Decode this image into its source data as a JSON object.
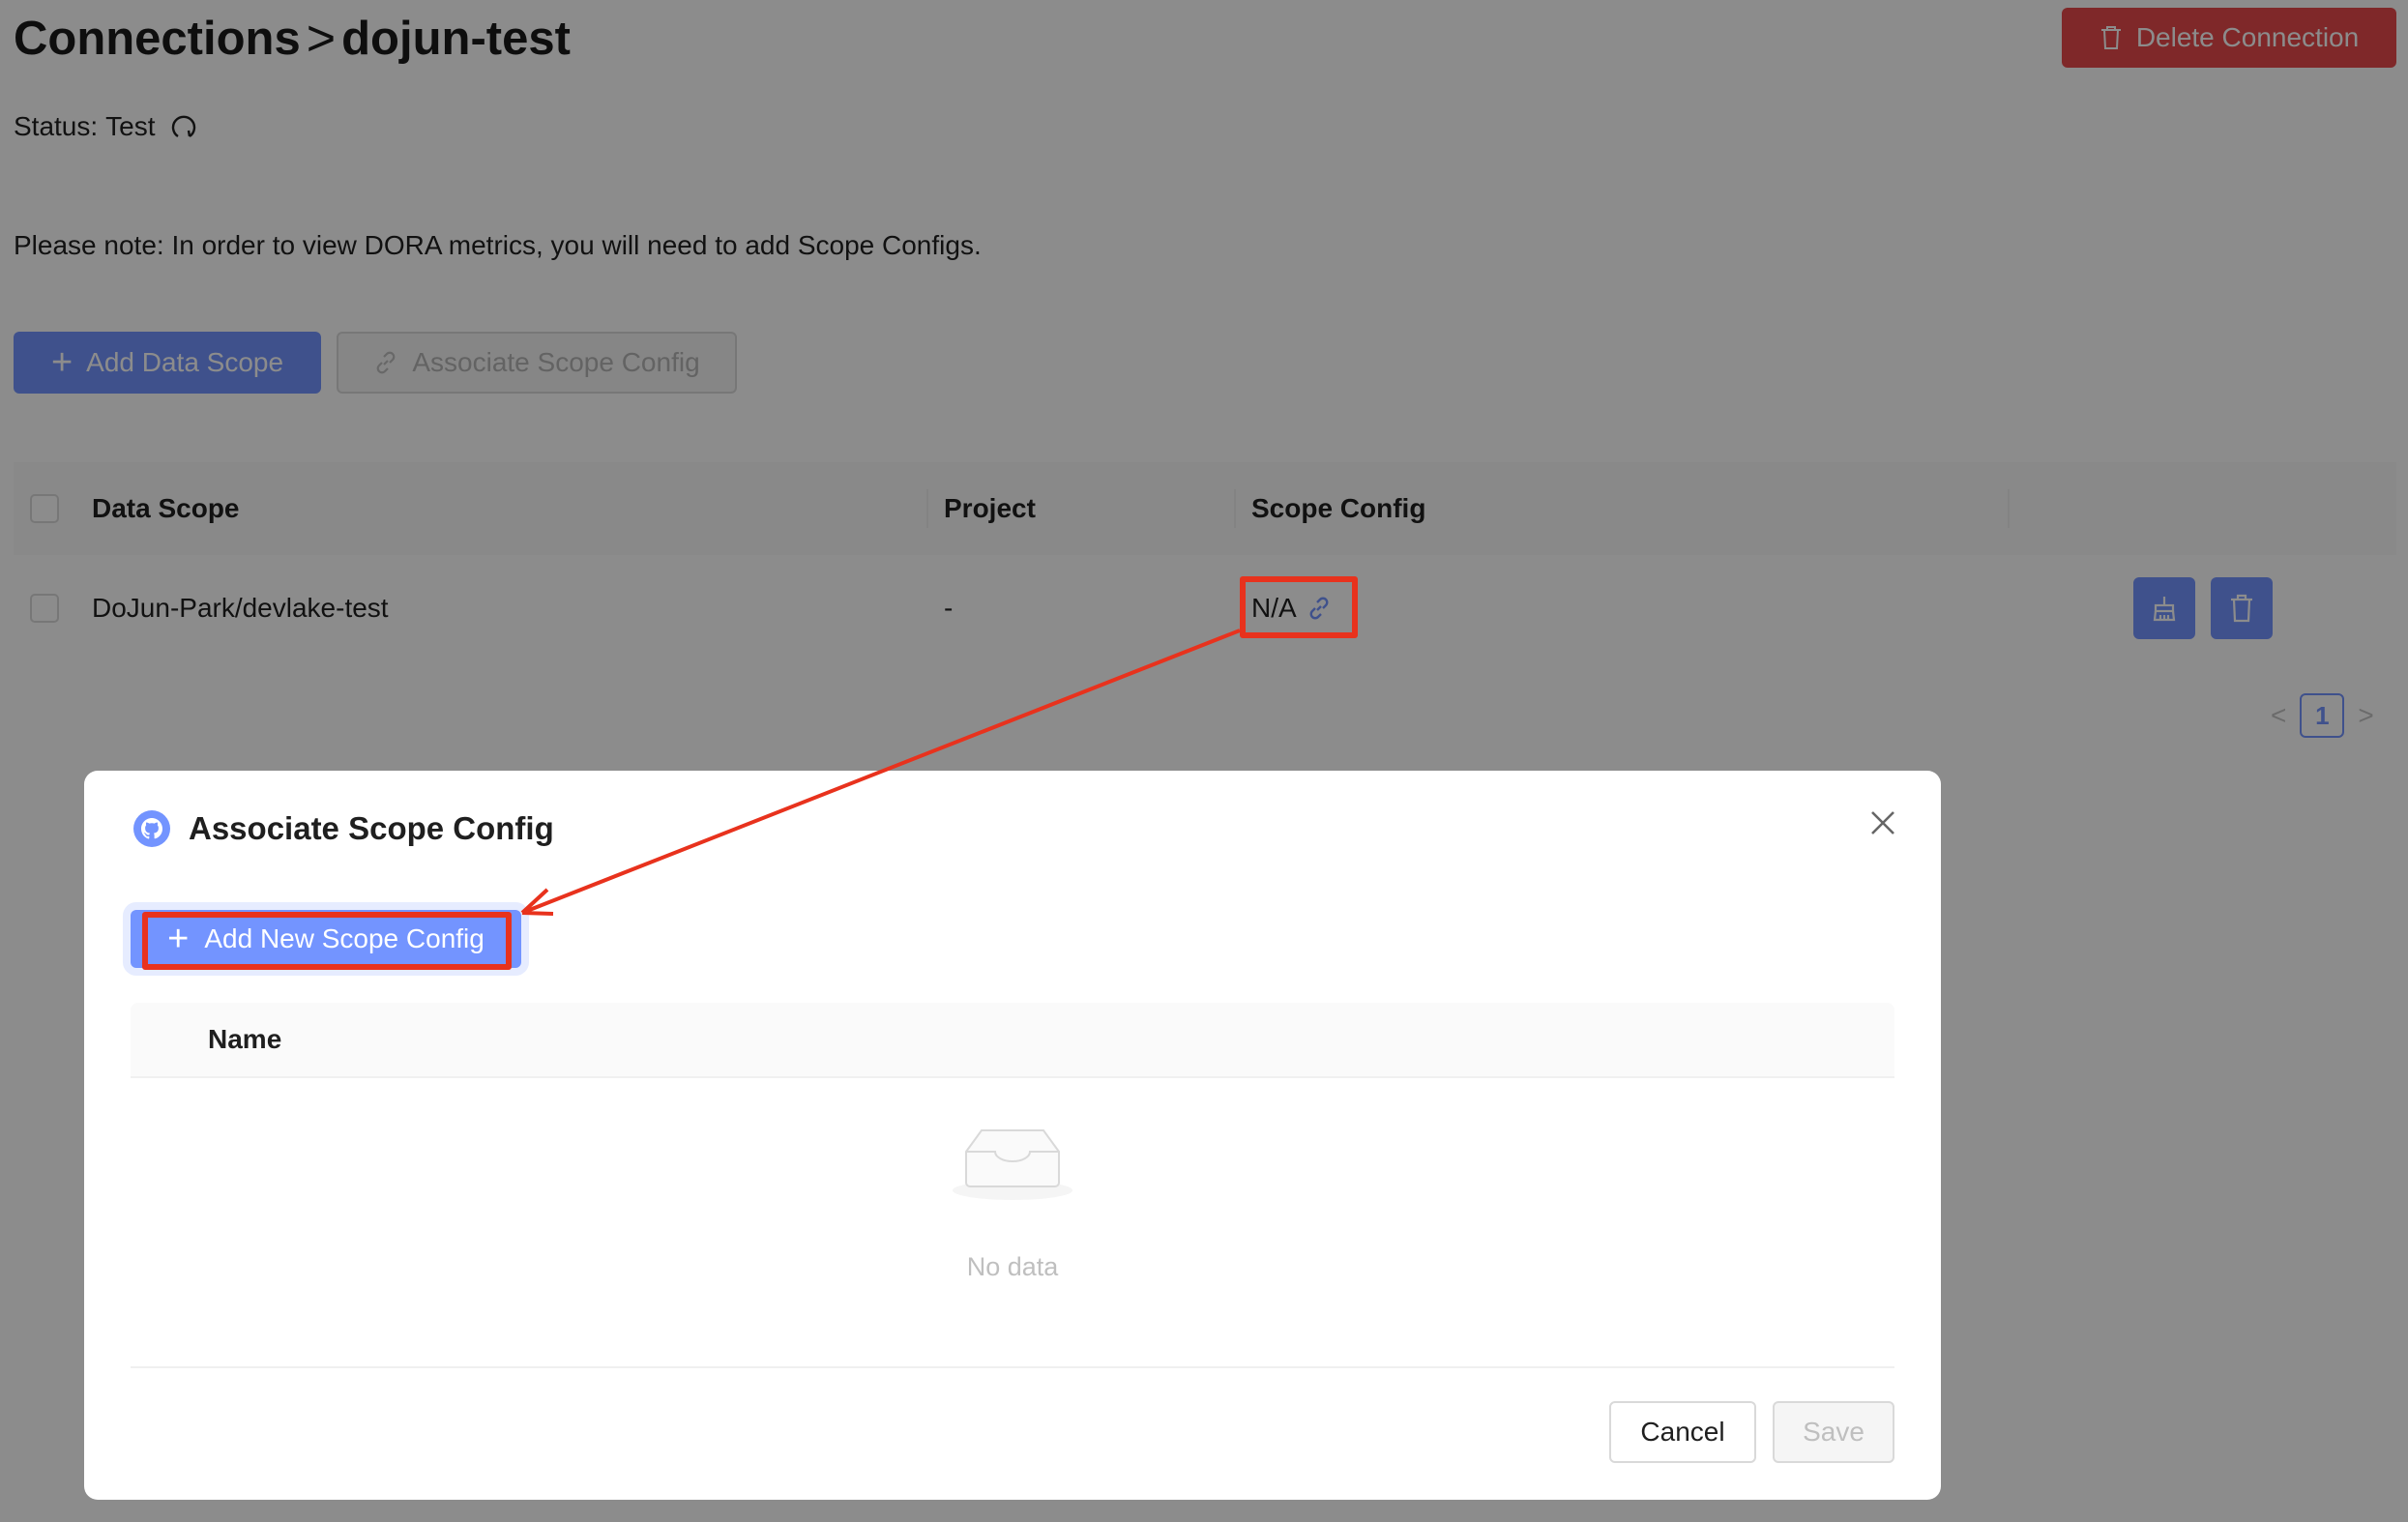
{
  "header": {
    "breadcrumb_root": "Connections",
    "breadcrumb_sep": ">",
    "breadcrumb_current": "dojun-test",
    "delete_label": "Delete Connection"
  },
  "status": {
    "label": "Status:",
    "value": "Test"
  },
  "note": "Please note: In order to view DORA metrics, you will need to add Scope Configs.",
  "actions": {
    "add_data_scope": "Add Data Scope",
    "associate_scope_config": "Associate Scope Config"
  },
  "table": {
    "columns": [
      "Data Scope",
      "Project",
      "Scope Config"
    ],
    "rows": [
      {
        "data_scope": "DoJun-Park/devlake-test",
        "project": "-",
        "scope_config": "N/A"
      }
    ]
  },
  "pagination": {
    "current": "1"
  },
  "modal": {
    "title": "Associate Scope Config",
    "add_button": "Add New Scope Config",
    "column_name": "Name",
    "empty_text": "No data",
    "cancel": "Cancel",
    "save": "Save"
  },
  "colors": {
    "primary": "#7394ff",
    "danger": "#e7494b",
    "annotation": "#e8321d"
  }
}
